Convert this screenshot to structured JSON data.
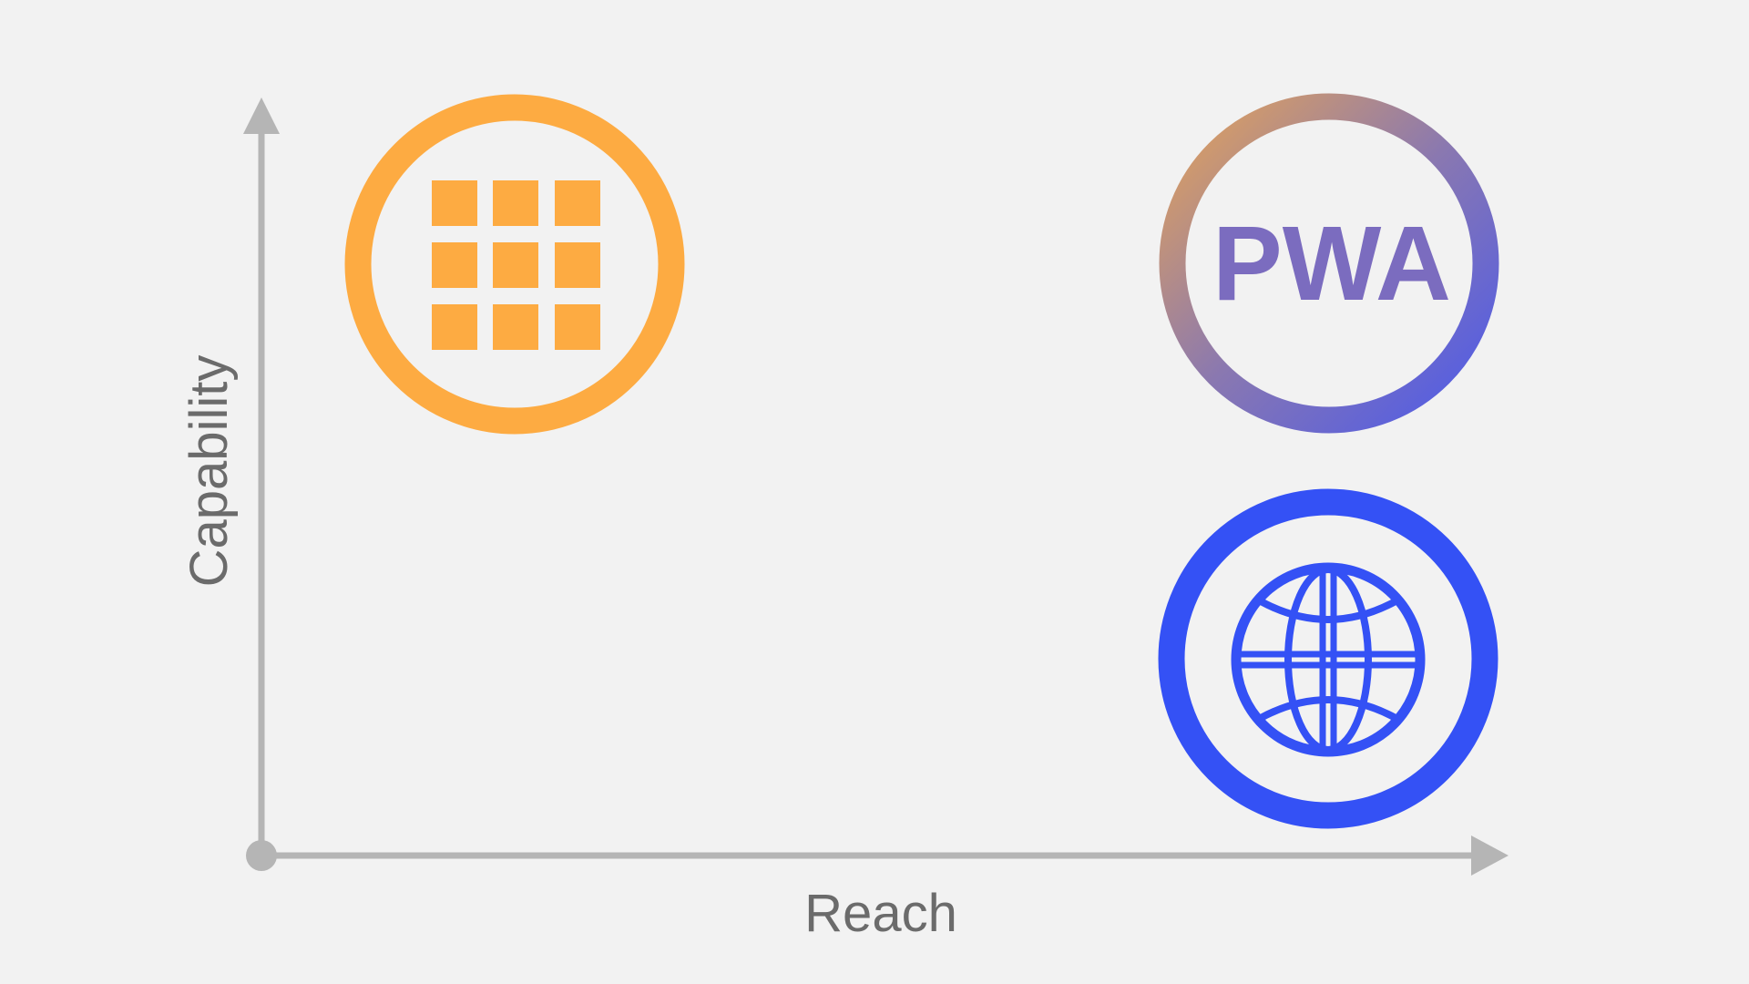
{
  "axes": {
    "x_label": "Reach",
    "y_label": "Capability",
    "color": "#b5b5b5",
    "label_color": "#6b6b6b"
  },
  "nodes": {
    "native_apps": {
      "icon": "app-grid-icon",
      "color": "#fdab42"
    },
    "pwa": {
      "text": "PWA",
      "text_color": "#7b6cbf",
      "ring_gradient": [
        "#e3a35a",
        "#8a78b0",
        "#4d5ae9"
      ]
    },
    "web": {
      "icon": "globe-icon",
      "color": "#3451f5"
    }
  },
  "background": "#f2f2f2"
}
